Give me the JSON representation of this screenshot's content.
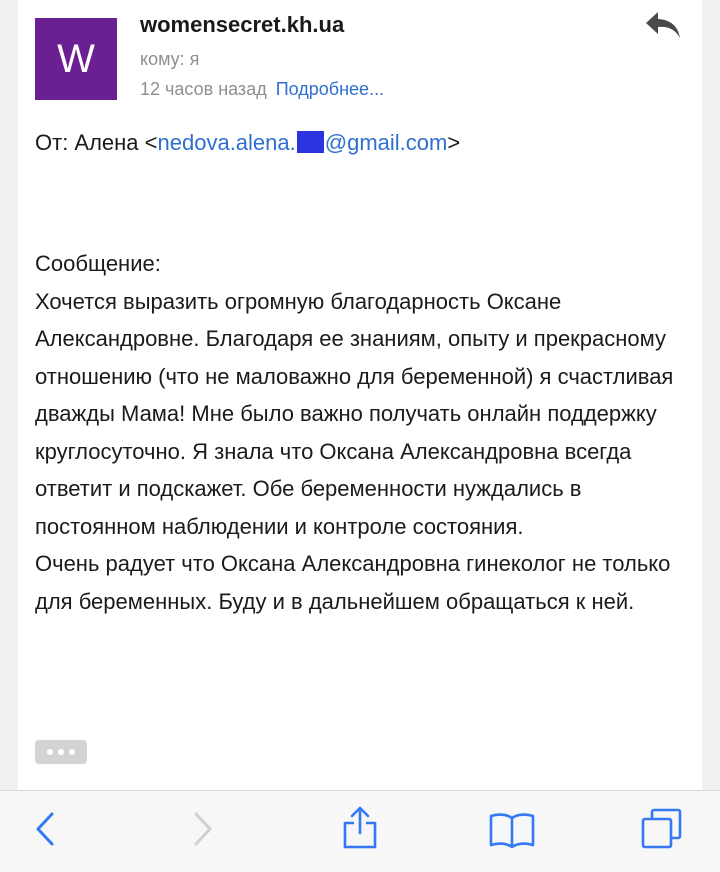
{
  "header": {
    "avatar_letter": "W",
    "sender": "womensecret.kh.ua",
    "to": "кому: я",
    "time": "12 часов назад",
    "details_link": "Подробнее..."
  },
  "from": {
    "prefix": "От: Алена <",
    "email_start": "nedova.alena.",
    "email_end": "@gmail.com",
    "suffix": ">"
  },
  "message": {
    "heading": "Сообщение:",
    "paragraph1": "Хочется выразить огромную благодарность Оксане Александровне. Благодаря ее знаниям, опыту и прекрасному отношению (что не маловажно для беременной) я счастливая дважды Мама!  Мне было важно получать онлайн поддержку круглосуточно. Я знала что Оксана Александровна всегда ответит и подскажет. Обе беременности нуждались в постоянном наблюдении и контроле состояния.",
    "paragraph2": "Очень радует что Оксана Александровна гинеколог не только для беременных.  Буду и в дальнейшем обращаться к ней."
  },
  "colors": {
    "avatar_bg": "#6a1f93",
    "link": "#2f6fcf",
    "redaction": "#2a35e0",
    "toolbar_icons": "#3478f6"
  },
  "icons": [
    "reply-icon",
    "back-icon",
    "forward-icon",
    "share-icon",
    "bookmarks-icon",
    "tabs-icon"
  ]
}
